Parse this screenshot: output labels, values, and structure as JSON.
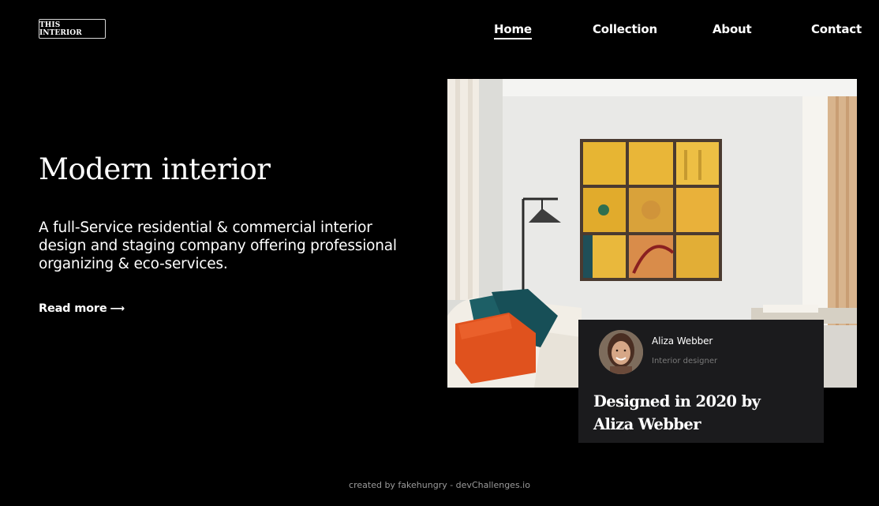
{
  "header": {
    "logo_text": "THIS INTERIOR",
    "nav": [
      {
        "label": "Home",
        "active": true
      },
      {
        "label": "Collection"
      },
      {
        "label": "About"
      },
      {
        "label": "Contact"
      }
    ]
  },
  "hero": {
    "title": "Modern interior",
    "description": "A full-Service residential & commercial interior design and staging company offering professional organizing & eco-services.",
    "read_more_label": "Read more",
    "read_more_icon": "arrow-right-icon"
  },
  "designer_card": {
    "name": "Aliza Webber",
    "role": "Interior designer",
    "designed_text": "Designed in 2020 by Aliza Webber"
  },
  "footer": {
    "credit": "created by fakehungry - devChallenges.io"
  },
  "colors": {
    "background": "#000000",
    "card": "#1b1b1d",
    "accent_yellow": "#e8b93a",
    "pillow_orange": "#e0521e",
    "pillow_teal": "#1d5f66"
  }
}
